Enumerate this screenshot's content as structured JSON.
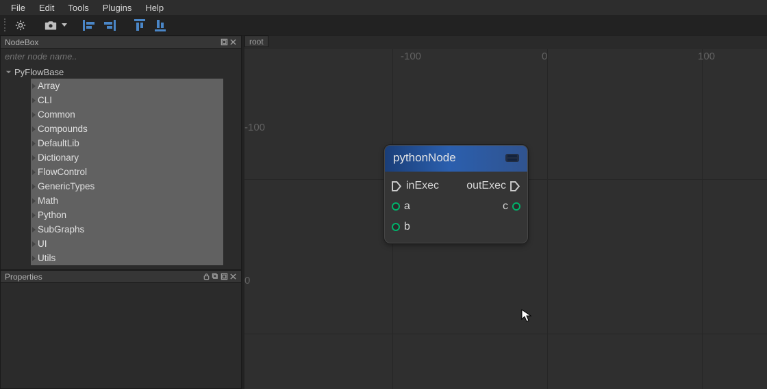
{
  "menubar": {
    "items": [
      "File",
      "Edit",
      "Tools",
      "Plugins",
      "Help"
    ]
  },
  "toolbar": {
    "items": [
      {
        "name": "gear-toolbar-btn",
        "icon": "gear"
      },
      {
        "name": "camera-toolbar-btn",
        "icon": "camera",
        "dropdown": true
      },
      {
        "name": "align-left-btn",
        "icon": "align-left"
      },
      {
        "name": "align-right-btn",
        "icon": "align-right"
      },
      {
        "name": "align-top-btn",
        "icon": "align-top"
      },
      {
        "name": "align-bottom-btn",
        "icon": "align-bottom"
      }
    ]
  },
  "nodebox": {
    "title": "NodeBox",
    "search_placeholder": "enter node name..",
    "root": {
      "label": "PyFlowBase",
      "expanded": true,
      "children": [
        "Array",
        "CLI",
        "Common",
        "Compounds",
        "DefaultLib",
        "Dictionary",
        "FlowControl",
        "GenericTypes",
        "Math",
        "Python",
        "SubGraphs",
        "UI",
        "Utils"
      ]
    }
  },
  "properties": {
    "title": "Properties"
  },
  "canvas": {
    "tab": "root",
    "axis_labels": {
      "x_neg100": "-100",
      "x_0": "0",
      "x_100": "100",
      "y_neg100": "-100",
      "y_0": "0"
    },
    "node": {
      "title": "pythonNode",
      "inputs_exec": [
        "inExec"
      ],
      "outputs_exec": [
        "outExec"
      ],
      "inputs_data": [
        "a",
        "b"
      ],
      "outputs_data": [
        "c"
      ]
    }
  }
}
